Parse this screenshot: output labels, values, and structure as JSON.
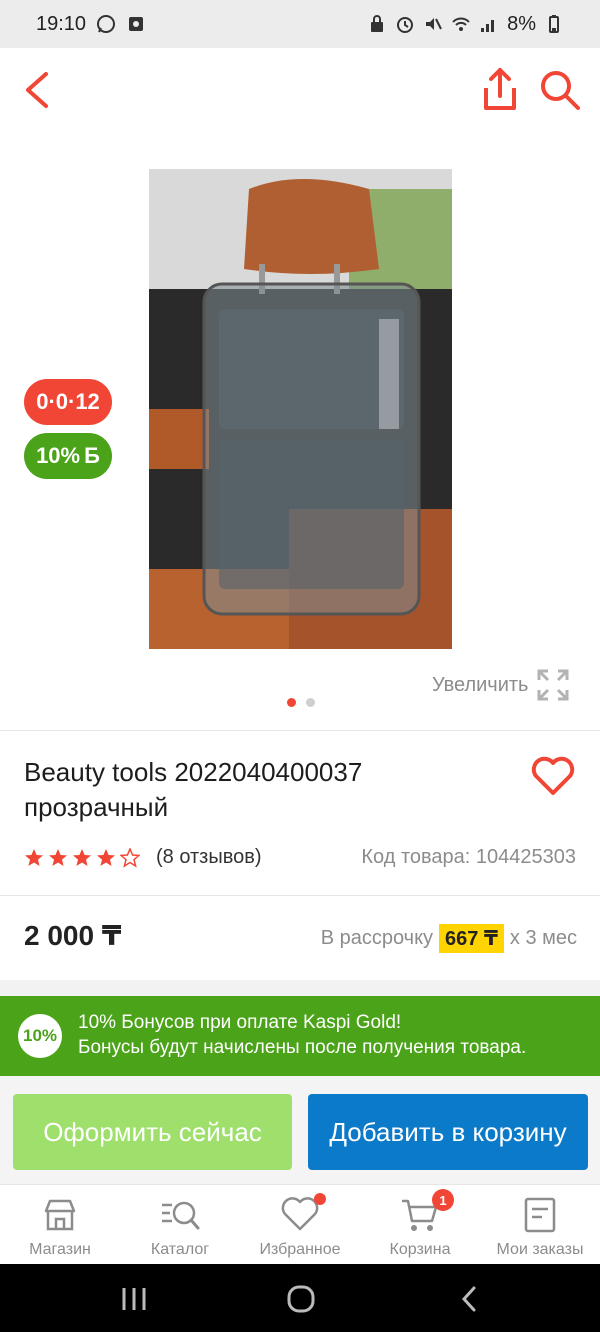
{
  "status_bar": {
    "time": "19:10",
    "battery": "8%"
  },
  "top_bar": {
    "icons": [
      "back-arrow-icon",
      "share-icon",
      "search-icon"
    ],
    "accent": "#f14635"
  },
  "badges": {
    "installment": "0·0·12",
    "bonus_percent": "10%",
    "bonus_symbol": "Б"
  },
  "gallery": {
    "zoom_label": "Увеличить",
    "total_images": 2,
    "active_index": 0
  },
  "product": {
    "title": "Beauty tools 2022040400037 прозрачный",
    "rating": 4,
    "rating_max": 5,
    "reviews": "(8 отзывов)",
    "code_label": "Код товара: 104425303",
    "price": "2 000 ₸",
    "installment_prefix": "В рассрочку",
    "installment_amount": "667 ₸",
    "installment_suffix": "x 3 мес"
  },
  "promo": {
    "badge": "10%",
    "line1": "10% Бонусов при оплате Kaspi Gold!",
    "line2": "Бонусы будут начислены после получения товара.",
    "color": "#4ba31a"
  },
  "buttons": {
    "buy_now": "Оформить сейчас",
    "add_to_cart": "Добавить в корзину"
  },
  "nav": {
    "items": [
      {
        "label": "Магазин",
        "icon": "shop-icon"
      },
      {
        "label": "Каталог",
        "icon": "catalog-search-icon"
      },
      {
        "label": "Избранное",
        "icon": "heart-icon"
      },
      {
        "label": "Корзина",
        "icon": "cart-icon",
        "badge": "1"
      },
      {
        "label": "Мои заказы",
        "icon": "orders-icon"
      }
    ]
  }
}
